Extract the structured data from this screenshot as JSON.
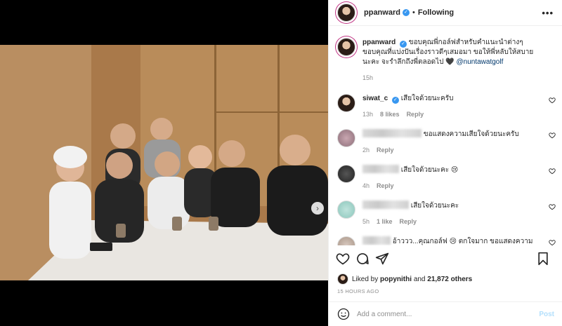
{
  "post": {
    "author": "ppanward",
    "follow_state": "Following",
    "more_glyph": "•••",
    "caption_user": "ppanward",
    "caption_text": "ขอบคุณพี่กอล์ฟสำหรับคำแนะนำต่างๆ ขอบคุณที่แบ่งปันเรื่องราวดีๆเสมอมา ขอให้พี่หลับให้สบายนะคะ จะรำลึกถึงพี่ตลอดไป 🖤",
    "caption_mention": "@nuntawatgolf",
    "caption_time": "15h"
  },
  "comments": [
    {
      "user": "siwat_c",
      "verified": true,
      "text": "เสียใจด้วยนะครับ",
      "time": "13h",
      "likes": "8 likes",
      "reply": "Reply"
    },
    {
      "user": "",
      "text": "ขอแสดงความเสียใจด้วยนะครับ",
      "time": "2h",
      "likes": "",
      "reply": "Reply"
    },
    {
      "user": "",
      "text": "เสียใจด้วยนะคะ 😢",
      "time": "4h",
      "likes": "",
      "reply": "Reply"
    },
    {
      "user": "",
      "text": "เสียใจด้วยนะคะ",
      "time": "5h",
      "likes": "1 like",
      "reply": "Reply"
    },
    {
      "user": "",
      "text": "อ้าววว...คุณกอล์ฟ 😢 ตกใจมาก ขอแสดงความเสียใจกับครอบครัวด้วยนะคะ 🖤🙏",
      "time": "",
      "likes": "",
      "reply": ""
    }
  ],
  "likes": {
    "prefix": "Liked by",
    "user": "popynithi",
    "connector": "and",
    "others": "21,872 others"
  },
  "timestamp": "15 HOURS AGO",
  "composer": {
    "placeholder": "Add a comment...",
    "post_label": "Post"
  },
  "icons": {
    "like": "heart-icon",
    "comment": "comment-bubble-icon",
    "share": "send-plane-icon",
    "save": "bookmark-icon",
    "emoji": "smiley-icon",
    "next": "chevron-right-icon",
    "tag": "person-tag-icon"
  },
  "colors": {
    "verified": "#3897f0",
    "muted": "#8e8e8e",
    "post_disabled": "#b2dffc",
    "mention": "#00376b"
  },
  "carousel": {
    "count": 4,
    "active_index": 0
  }
}
